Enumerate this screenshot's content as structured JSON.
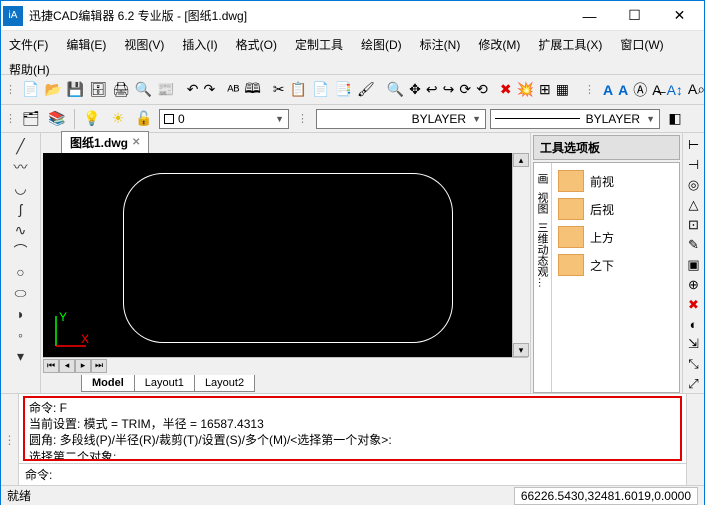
{
  "title": "迅捷CAD编辑器 6.2 专业版  - [图纸1.dwg]",
  "menus": [
    "文件(F)",
    "编辑(E)",
    "视图(V)",
    "插入(I)",
    "格式(O)",
    "定制工具",
    "绘图(D)",
    "标注(N)",
    "修改(M)",
    "扩展工具(X)",
    "窗口(W)",
    "帮助(H)"
  ],
  "doc_tab": {
    "label": "图纸1.dwg"
  },
  "layer_dropdown": {
    "value": "0"
  },
  "linetype_dropdown": {
    "value": "BYLAYER"
  },
  "lineweight_dropdown": {
    "value": "BYLAYER"
  },
  "layout_tabs": [
    "Model",
    "Layout1",
    "Layout2"
  ],
  "palette": {
    "title": "工具选项板",
    "groups": [
      "画",
      "视图",
      "三维动态观…"
    ],
    "items": [
      "前视",
      "后视",
      "上方",
      "之下"
    ]
  },
  "cmd_history": [
    "命令:  F",
    "当前设置: 模式 = TRIM，半径 = 16587.4313",
    "圆角: 多段线(P)/半径(R)/裁剪(T)/设置(S)/多个(M)/<选择第一个对象>:",
    "选择第二个对象:"
  ],
  "cmd_prompt": "命令: ",
  "status": {
    "left": "就绪",
    "coords": "66226.5430,32481.6019,0.0000"
  },
  "icons": {
    "bulb": "💡",
    "sun": "☀",
    "layers": "▤",
    "color": "◧",
    "new": "📄",
    "open": "📂",
    "save": "💾",
    "saveall": "🗄",
    "print": "🖨",
    "preview": "🔍",
    "plot": "📰",
    "undo": "↶",
    "redo": "↷",
    "spell": "ᴬᴮ",
    "find": "🕮",
    "cut": "✂",
    "copy": "📋",
    "paste": "📄",
    "pastespec": "📑",
    "matchprop": "🖌",
    "zoom": "🔍",
    "pan": "✥",
    "back": "↩",
    "fwd": "↪",
    "rot": "⟳",
    "refresh": "⟲",
    "delete": "✖",
    "explode": "💥",
    "line": "╱",
    "pline": "〰",
    "arc": "◡",
    "circle": "○",
    "rect": "▭",
    "poly": "⬠",
    "ellipse": "⬭",
    "spline": "∿",
    "point": "·",
    "hatch": "▦",
    "A": "A",
    "Ax": "A",
    "table": "⊞",
    "dim1": "⊢",
    "dim2": "⊣",
    "dim3": "◎",
    "dim4": "△",
    "dim5": "⊡",
    "dim6": "✎",
    "dim7": "▣",
    "dim8": "⊕",
    "dim9": "✖",
    "dim10": "◐",
    "dim11": "⇲",
    "dim12": "⤡",
    "dim13": "⤢",
    "dim14": "↔",
    "dim15": "↕",
    "dim16": "⊟"
  }
}
